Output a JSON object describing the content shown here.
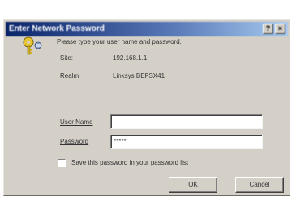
{
  "dialog": {
    "title": "Enter Network Password",
    "controls": {
      "help": "?",
      "close": "×"
    },
    "prompt": "Please type your user name and password.",
    "site_label": "Site:",
    "site_value": "192.168.1.1",
    "realm_label": "Realm",
    "realm_value": "Linksys BEFSX41",
    "username_label": "User Name",
    "username_value": "",
    "password_label": "Password",
    "password_value": "*****",
    "save_password_label": "Save this password in your password list",
    "save_password_checked": false,
    "ok_label": "OK",
    "cancel_label": "Cancel"
  },
  "icons": {
    "key": "key-icon"
  },
  "colors": {
    "titlebar_start": "#0a246a",
    "titlebar_end": "#a6caf0",
    "dialog_face": "#d4d0c8"
  }
}
